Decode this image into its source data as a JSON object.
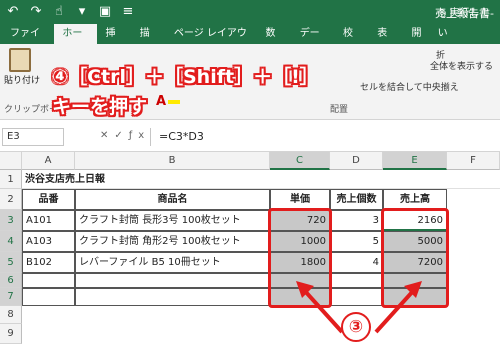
{
  "titlebar": {
    "doc_title": "売上報告書-"
  },
  "tabs": [
    {
      "label": "ファイル"
    },
    {
      "label": "ホーム"
    },
    {
      "label": "挿入"
    },
    {
      "label": "描画"
    },
    {
      "label": "ページ レイアウト"
    },
    {
      "label": "数式"
    },
    {
      "label": "データ"
    },
    {
      "label": "校閲"
    },
    {
      "label": "表示"
    },
    {
      "label": "開発"
    }
  ],
  "tell_me": "実行したい",
  "ribbon": {
    "paste_label": "貼り付け",
    "clipboard_group": "クリップボード",
    "wrap_text": "全体を表示する",
    "merge_center": "セルを結合して中央揃え",
    "alignment_group": "配置",
    "fold_label": "折"
  },
  "callout": {
    "line1": "④［Ctrl］＋［Shift］＋［!］",
    "line2": "キーを押す",
    "step3": "③"
  },
  "formula_bar": {
    "name_box": "E3",
    "formula": "=C3*D3"
  },
  "columns": [
    "A",
    "B",
    "C",
    "D",
    "E",
    "F"
  ],
  "rows": [
    "1",
    "2",
    "3",
    "4",
    "5",
    "6",
    "7",
    "8",
    "9"
  ],
  "sheet": {
    "title": "渋谷支店売上日報",
    "headers": [
      "品番",
      "商品名",
      "単価",
      "売上個数",
      "売上高"
    ],
    "data": [
      [
        "A101",
        "クラフト封筒 長形3号 100枚セット",
        "720",
        "3",
        "2160"
      ],
      [
        "A103",
        "クラフト封筒 角形2号 100枚セット",
        "1000",
        "5",
        "5000"
      ],
      [
        "B102",
        "レバーファイル B5 10冊セット",
        "1800",
        "4",
        "7200"
      ]
    ]
  },
  "colors": {
    "excel_green": "#217346",
    "highlight_red": "#e21d1d",
    "selected_fill": "#c8c8c8"
  }
}
